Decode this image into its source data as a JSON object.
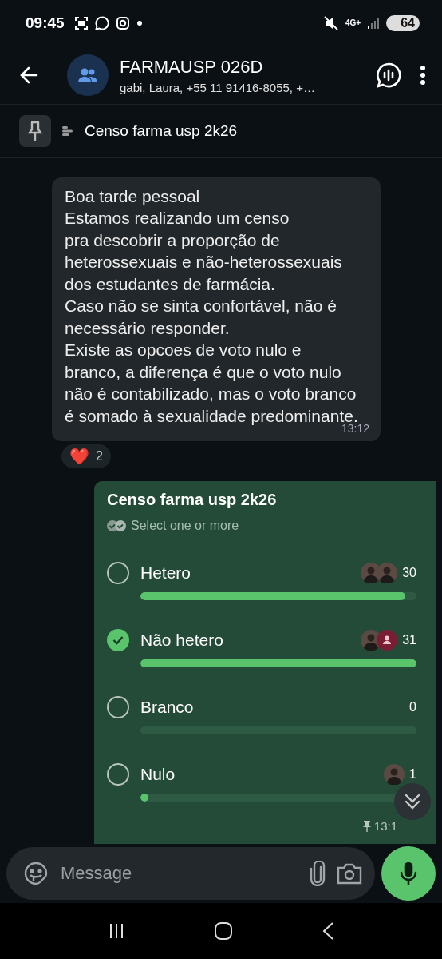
{
  "status_bar": {
    "time": "09:45",
    "network": "4G+",
    "battery": "64"
  },
  "header": {
    "title": "FARMAUSP 026D",
    "subtitle": "gabi, Laura, +55 11 91416-8055, +…"
  },
  "pinned": {
    "text": "Censo farma usp 2k26"
  },
  "message": {
    "text": "Boa tarde pessoal\nEstamos realizando um censo\npra descobrir a proporção de heterossexuais e não-heterossexuais dos estudantes de farmácia.\nCaso não se sinta confortável, não é necessário responder.\nExiste as opcoes de voto nulo e branco, a diferença é que o voto nulo não é contabilizado, mas o voto branco é somado à sexualidade predominante.",
    "time": "13:12",
    "reaction": {
      "emoji": "❤️",
      "count": "2"
    }
  },
  "poll": {
    "title": "Censo farma usp 2k26",
    "hint": "Select one or more",
    "time": "13:1",
    "pinned": true,
    "options": [
      {
        "label": "Hetero",
        "count": "30",
        "level": 0.96,
        "selected": false,
        "avatars": [
          {
            "kind": "photo"
          },
          {
            "kind": "photo"
          }
        ]
      },
      {
        "label": "Não hetero",
        "count": "31",
        "level": 1,
        "selected": true,
        "avatars": [
          {
            "kind": "photo"
          },
          {
            "kind": "default"
          }
        ]
      },
      {
        "label": "Branco",
        "count": "0",
        "selected": false
      },
      {
        "label": "Nulo",
        "count": "1",
        "level": 0.03,
        "selected": false,
        "avatars": [
          {
            "kind": "photo"
          }
        ]
      }
    ]
  },
  "composer": {
    "placeholder": "Message"
  }
}
